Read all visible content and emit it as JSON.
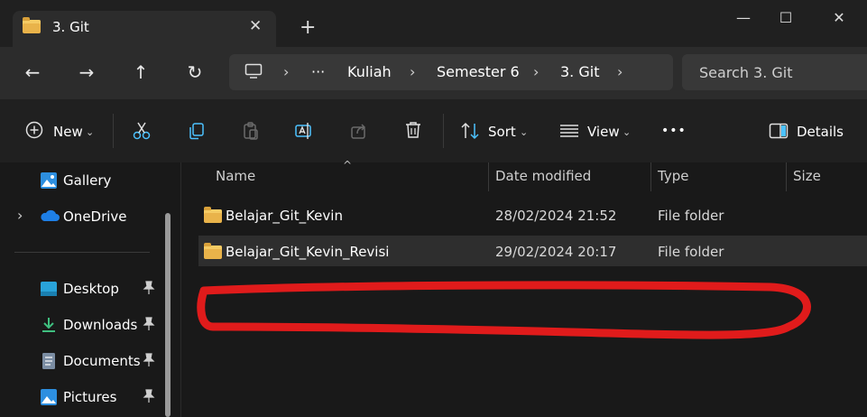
{
  "window": {
    "tab_title": "3. Git",
    "tab_close": "✕",
    "new_tab": "+",
    "minimize": "—",
    "maximize": "☐",
    "close": "✕"
  },
  "nav": {
    "back": "←",
    "forward": "→",
    "up": "↑",
    "refresh": "↻"
  },
  "breadcrumb": {
    "more": "···",
    "separator": "›",
    "items": [
      "Kuliah",
      "Semester 6",
      "3. Git"
    ]
  },
  "search": {
    "placeholder": "Search 3. Git"
  },
  "toolbar": {
    "new_label": "New",
    "sort_label": "Sort",
    "view_label": "View",
    "more_label": "•••",
    "details_label": "Details",
    "chevron": "⌄"
  },
  "sidebar": {
    "items": [
      {
        "label": "Gallery",
        "icon": "gallery-icon"
      },
      {
        "label": "OneDrive",
        "icon": "onedrive-icon"
      },
      {
        "label": "Desktop",
        "icon": "desktop-icon",
        "pinned": true
      },
      {
        "label": "Downloads",
        "icon": "downloads-icon",
        "pinned": true
      },
      {
        "label": "Documents",
        "icon": "documents-icon",
        "pinned": true
      },
      {
        "label": "Pictures",
        "icon": "pictures-icon",
        "pinned": true
      }
    ],
    "expander": "›",
    "pin_glyph": "📌"
  },
  "columns": {
    "name": "Name",
    "date_modified": "Date modified",
    "type": "Type",
    "size": "Size",
    "sort_caret": "^"
  },
  "files": [
    {
      "name": "Belajar_Git_Kevin",
      "date": "28/02/2024 21:52",
      "type": "File folder"
    },
    {
      "name": "Belajar_Git_Kevin_Revisi",
      "date": "29/02/2024 20:17",
      "type": "File folder"
    }
  ],
  "colors": {
    "folder": "#e9b34a",
    "annotation": "#e01b1b",
    "accent": "#4cc2ff"
  }
}
